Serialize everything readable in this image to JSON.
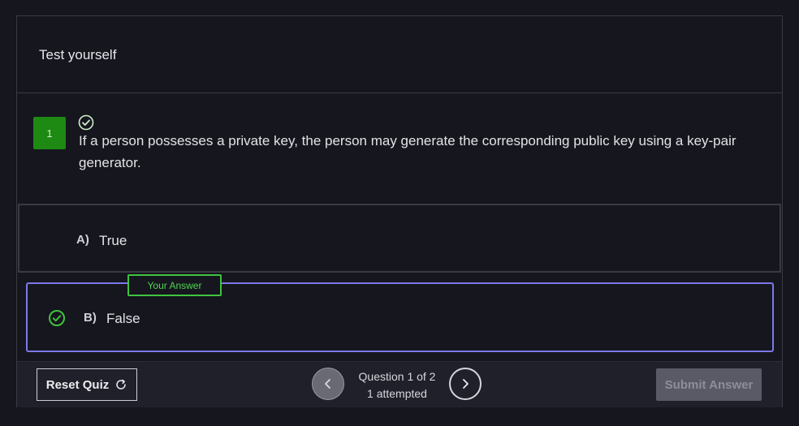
{
  "quiz": {
    "title": "Test yourself"
  },
  "question": {
    "number": "1",
    "text": "If a person possesses a private key, the person may generate the corresponding public key using a key-pair generator.",
    "status_icon": "check-circle-icon"
  },
  "options": [
    {
      "letter": "A)",
      "text": "True"
    },
    {
      "letter": "B)",
      "text": "False",
      "badge": "Your Answer",
      "icon": "check-circle-icon"
    }
  ],
  "footer": {
    "reset_label": "Reset Quiz",
    "reset_icon": "refresh-icon",
    "progress_line1": "Question 1 of 2",
    "progress_line2": "1 attempted",
    "submit_label": "Submit Answer",
    "prev_icon": "chevron-left-icon",
    "next_icon": "chevron-right-icon"
  },
  "colors": {
    "background": "#16161e",
    "correct": "#3ec43e",
    "selected_border": "#7b79e8",
    "question_badge": "#1e8a14"
  }
}
